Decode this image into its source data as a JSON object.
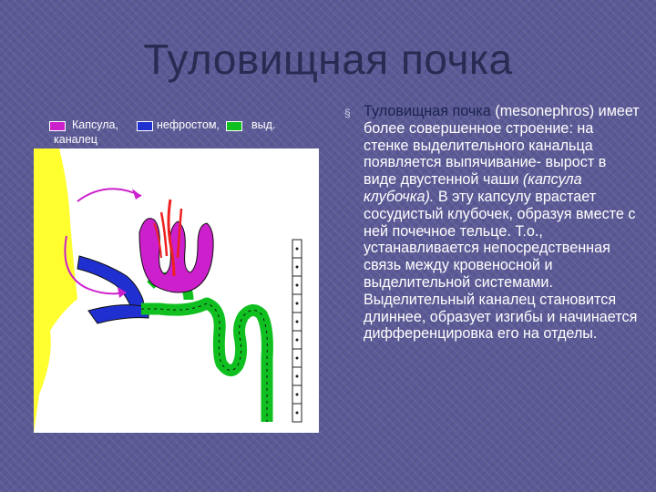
{
  "slide": {
    "title": "Туловищная почка"
  },
  "legend": {
    "items": [
      {
        "label": "Капсула,",
        "color": "#cc20cc"
      },
      {
        "label": "нефростом,",
        "color": "#2030d0"
      },
      {
        "label": "выд.",
        "color": "#10c020"
      }
    ],
    "wrap_text": "каналец"
  },
  "figure": {
    "colors": {
      "capsule": "#cc20cc",
      "nephrostome": "#2030d0",
      "duct": "#10c020",
      "blood": "#ee2020",
      "tissue": "#ffff30"
    }
  },
  "body": {
    "bullet": "§",
    "highlight": "Туловищная почка",
    "text_1": " (mesonephros) имеет более совершенное строение: на стенке выделительного канальца появляется выпячивание- вырост в виде двустенной чаши ",
    "text_italic": "(капсула клубочка).",
    "text_2": " В эту капсулу врастает сосудистый клубочек, образуя вместе с ней почечное тельце. Т.о., устанавливается непосредственная связь между кровеносной и выделительной системами. Выделительный каналец становится длиннее, образует изгибы и начинается дифференцировка его на отделы."
  }
}
